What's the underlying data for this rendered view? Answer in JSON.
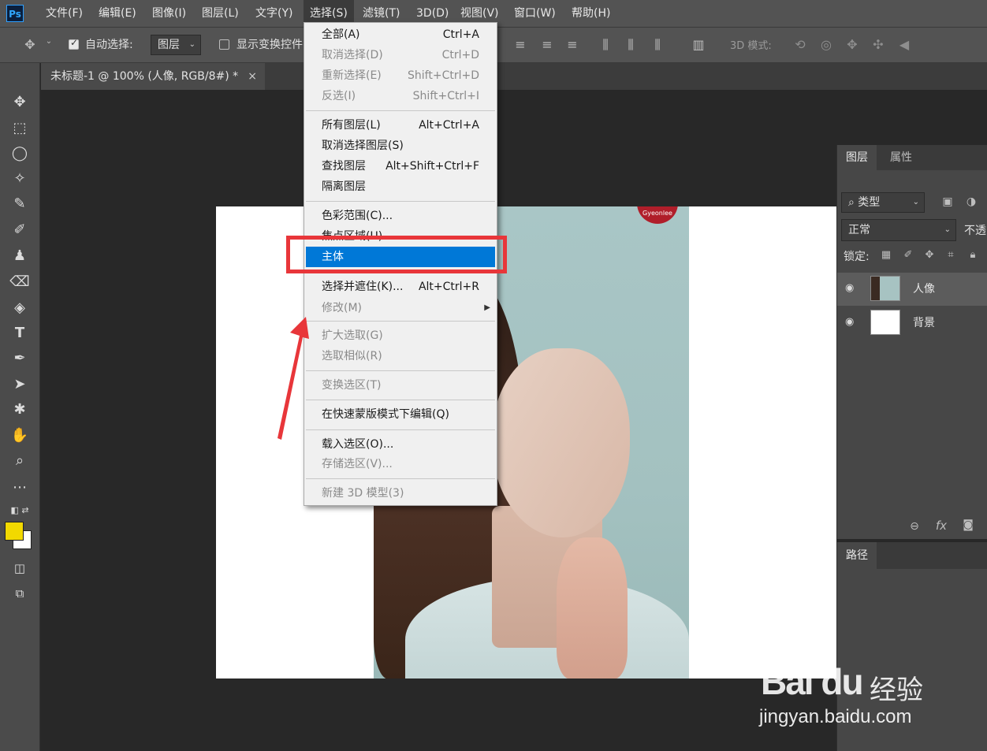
{
  "app": {
    "logo": "Ps"
  },
  "menubar": {
    "items": [
      "文件(F)",
      "编辑(E)",
      "图像(I)",
      "图层(L)",
      "文字(Y)",
      "选择(S)",
      "滤镜(T)",
      "3D(D)",
      "视图(V)",
      "窗口(W)",
      "帮助(H)"
    ],
    "active": "选择(S)"
  },
  "options": {
    "auto_select_label": "自动选择:",
    "auto_select_checked": true,
    "auto_select_target": "图层",
    "show_transform_label": "显示变换控件",
    "mode_3d_label": "3D 模式:"
  },
  "document": {
    "tab_title": "未标题-1 @ 100% (人像, RGB/8#) *",
    "close_glyph": "×",
    "photo_badge": "Gyeonlee"
  },
  "select_menu": {
    "groups": [
      [
        {
          "label": "全部(A)",
          "shortcut": "Ctrl+A",
          "enabled": true
        },
        {
          "label": "取消选择(D)",
          "shortcut": "Ctrl+D",
          "enabled": false
        },
        {
          "label": "重新选择(E)",
          "shortcut": "Shift+Ctrl+D",
          "enabled": false
        },
        {
          "label": "反选(I)",
          "shortcut": "Shift+Ctrl+I",
          "enabled": false
        }
      ],
      [
        {
          "label": "所有图层(L)",
          "shortcut": "Alt+Ctrl+A",
          "enabled": true
        },
        {
          "label": "取消选择图层(S)",
          "shortcut": "",
          "enabled": true
        },
        {
          "label": "查找图层",
          "shortcut": "Alt+Shift+Ctrl+F",
          "enabled": true
        },
        {
          "label": "隔离图层",
          "shortcut": "",
          "enabled": true
        }
      ],
      [
        {
          "label": "色彩范围(C)...",
          "shortcut": "",
          "enabled": true
        },
        {
          "label": "焦点区域(U)...",
          "shortcut": "",
          "enabled": true
        },
        {
          "label": "主体",
          "shortcut": "",
          "enabled": true,
          "highlighted": true
        }
      ],
      [
        {
          "label": "选择并遮住(K)...",
          "shortcut": "Alt+Ctrl+R",
          "enabled": true
        },
        {
          "label": "修改(M)",
          "shortcut": "",
          "enabled": false,
          "submenu": true
        }
      ],
      [
        {
          "label": "扩大选取(G)",
          "shortcut": "",
          "enabled": false
        },
        {
          "label": "选取相似(R)",
          "shortcut": "",
          "enabled": false
        }
      ],
      [
        {
          "label": "变换选区(T)",
          "shortcut": "",
          "enabled": false
        }
      ],
      [
        {
          "label": "在快速蒙版模式下编辑(Q)",
          "shortcut": "",
          "enabled": true
        }
      ],
      [
        {
          "label": "载入选区(O)...",
          "shortcut": "",
          "enabled": true
        },
        {
          "label": "存储选区(V)...",
          "shortcut": "",
          "enabled": false
        }
      ],
      [
        {
          "label": "新建 3D 模型(3)",
          "shortcut": "",
          "enabled": false
        }
      ]
    ]
  },
  "layers_panel": {
    "tabs": [
      "图层",
      "属性"
    ],
    "filter_label": "类型",
    "blend_mode": "正常",
    "opacity_label": "不透",
    "lock_label": "锁定:",
    "layers": [
      {
        "name": "人像",
        "selected": true
      },
      {
        "name": "背景",
        "selected": false
      }
    ]
  },
  "paths_panel": {
    "tab": "路径"
  },
  "colors": {
    "foreground": "#f2d900",
    "background": "#ffffff",
    "highlight": "#0078d7",
    "annotation": "#e8363a"
  },
  "watermark": {
    "logo": "Bai du",
    "cn": "经验",
    "url": "jingyan.baidu.com"
  }
}
